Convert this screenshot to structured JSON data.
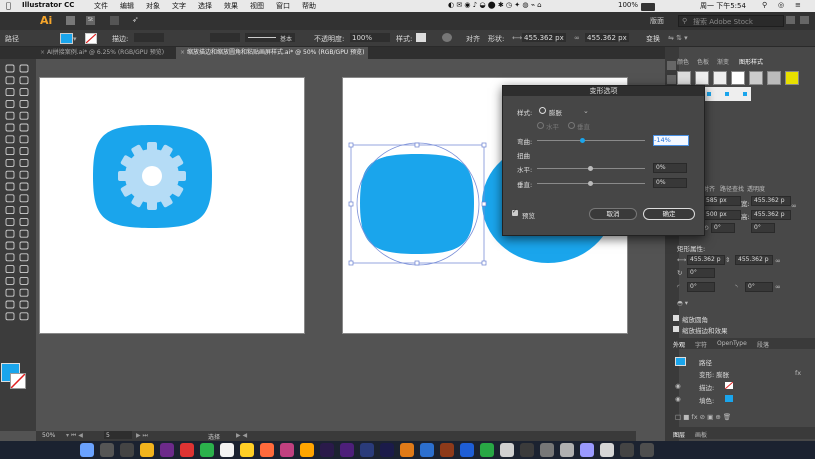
{
  "menubar": {
    "app": "Illustrator CC",
    "items": [
      "文件",
      "编辑",
      "对象",
      "文字",
      "选择",
      "效果",
      "视图",
      "窗口",
      "帮助"
    ],
    "battery": "100%",
    "clock": "周一 下午5:54"
  },
  "appbar": {
    "logo": "Ai",
    "workspace": "基本",
    "layout": "版面",
    "search_placeholder": "搜索 Adobe Stock"
  },
  "controlbar": {
    "selection_label": "路径",
    "stroke_label": "描边:",
    "stroke_style": "基本",
    "opacity_label": "不透明度:",
    "opacity_value": "100%",
    "style_label": "样式:",
    "align_label": "对齐",
    "shape_label": "形状:",
    "w_value": "455.362 px",
    "h_value": "455.362 px",
    "transform_label": "变换"
  },
  "tabs": [
    "AI拼接案例.ai* @ 6.25% (RGB/GPU 预览)",
    "缩放描边和缩放圆角和粘贴画屏样式.ai* @ 50% (RGB/GPU 预览)"
  ],
  "dialog": {
    "title": "变形选项",
    "style_label": "样式:",
    "style_value": "膨胀",
    "horizontal_radio": "水平",
    "vertical_radio": "垂直",
    "bend_label": "弯曲:",
    "bend_value": "-14%",
    "distortion_label": "扭曲",
    "dh_label": "水平:",
    "dh_value": "0%",
    "dv_label": "垂直:",
    "dv_value": "0%",
    "preview_label": "预览",
    "cancel_label": "取消",
    "ok_label": "确定",
    "bend_percent": -14,
    "dh_percent": 0,
    "dv_percent": 0
  },
  "rightpanel": {
    "tabs_top": [
      "颜色",
      "色板",
      "渐变",
      "图形样式"
    ],
    "tabs_mid": [
      "对齐",
      "路径查找",
      "透明度"
    ],
    "x_value": "585 px",
    "y_value": "500 px",
    "w_label": "宽:",
    "h_label": "高:",
    "w_value": "455.362 p",
    "h_value": "455.362 p",
    "angle1": "0°",
    "angle2": "0°",
    "rect_props": "矩形属性:",
    "rw": "455.362 p",
    "rh": "455.362 p",
    "a3": "0°",
    "r1": "0°",
    "r2": "0°",
    "scale_corners": "缩放圆角",
    "scale_strokes": "缩放描边和效果",
    "tabs_bottom": [
      "外观",
      "字符",
      "OpenType",
      "段落"
    ],
    "path_label": "路径",
    "warp_label": "变形: 膨胀",
    "stroke_label": "描边:",
    "fill_label": "填色:",
    "footer_tabs": [
      "图层",
      "画板"
    ],
    "fx": "fx"
  },
  "statusbar": {
    "zoom": "50%",
    "page": "5",
    "mode": "选择"
  },
  "colors": {
    "accent": "#1aa5ec",
    "gear_light": "#b5dcf6"
  }
}
